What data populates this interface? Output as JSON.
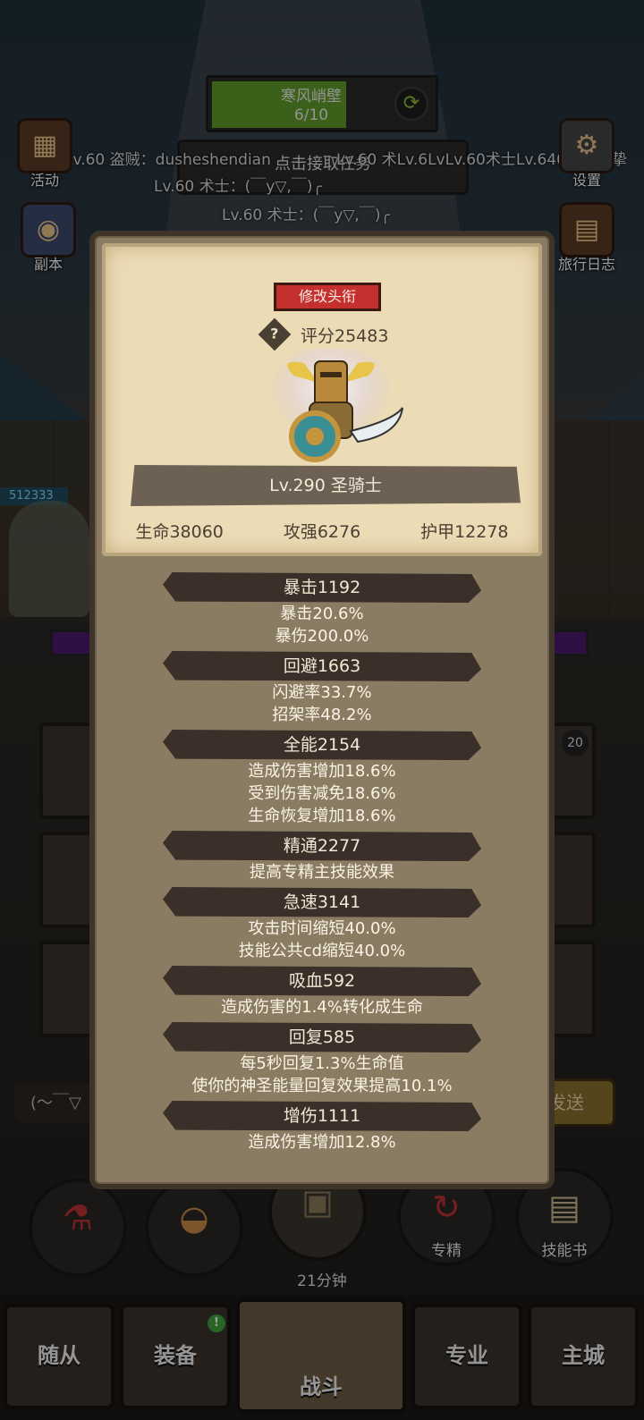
{
  "background": {
    "quest": {
      "name": "寒风峭壁",
      "progress": "6/10",
      "progress_fraction": 0.6,
      "button_label": "点击接取任务"
    },
    "chat_lines": [
      "Lv.60 盗贼：dusheshendian",
      "Lv.60 术士：(￣y▽,￣)╭",
      "Lv.60 术士：(￣y▽,￣)╭",
      "Lv.60 术Lv.6LvLv.60术士Lv.640深渊之挚"
    ],
    "side_buttons": {
      "activity": "活动",
      "dungeon": "副本",
      "settings": "设置",
      "journal": "旅行日志"
    },
    "hp_tag": "512333",
    "slot_count": "20",
    "chat_input": "(～￣▽",
    "send_label": "发送",
    "action_buttons": {
      "specialty": "专精",
      "skill_book": "技能书",
      "timer": "21分钟"
    },
    "nav": {
      "followers": "随从",
      "equipment": "装备",
      "battle": "战斗",
      "profession": "专业",
      "main_city": "主城",
      "equipment_badge": "!"
    }
  },
  "card": {
    "title_button": "修改头衔",
    "help_icon": "?",
    "score": "评分25483",
    "name": "Lv.290 圣骑士",
    "hp": "生命38060",
    "attack": "攻强6276",
    "armor": "护甲12278"
  },
  "stats": [
    {
      "head": "暴击1192",
      "lines": [
        "暴击20.6%",
        "暴伤200.0%"
      ]
    },
    {
      "head": "回避1663",
      "lines": [
        "闪避率33.7%",
        "招架率48.2%"
      ]
    },
    {
      "head": "全能2154",
      "lines": [
        "造成伤害增加18.6%",
        "受到伤害减免18.6%",
        "生命恢复增加18.6%"
      ]
    },
    {
      "head": "精通2277",
      "lines": [
        "提高专精主技能效果"
      ]
    },
    {
      "head": "急速3141",
      "lines": [
        "攻击时间缩短40.0%",
        "技能公共cd缩短40.0%"
      ]
    },
    {
      "head": "吸血592",
      "lines": [
        "造成伤害的1.4%转化成生命"
      ]
    },
    {
      "head": "回复585",
      "lines": [
        "每5秒回复1.3%生命值",
        "使你的神圣能量回复效果提高10.1%"
      ]
    },
    {
      "head": "增伤1111",
      "lines": [
        "造成伤害增加12.8%"
      ]
    }
  ]
}
